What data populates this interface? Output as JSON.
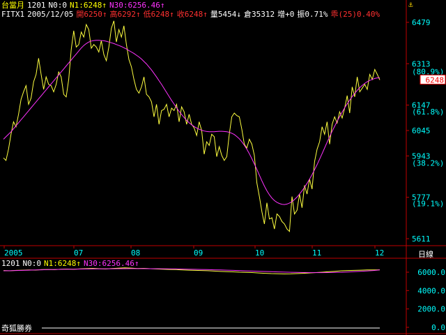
{
  "header": {
    "line1": [
      {
        "text": "台當月",
        "color": "#ffff00"
      },
      {
        "text": "1201",
        "color": "#ffffff"
      },
      {
        "text": "N0:0",
        "color": "#ffffff"
      },
      {
        "text": "N1:6248↑",
        "color": "#ffff00"
      },
      {
        "text": "N30:6256.46↑",
        "color": "#ff33ff"
      }
    ],
    "line2": [
      {
        "text": "FITX1",
        "color": "#ffffff"
      },
      {
        "text": "2005/12/05",
        "color": "#ffffff"
      },
      {
        "text": "開6250↑",
        "color": "#ff3030"
      },
      {
        "text": "高6292↑",
        "color": "#ff3030"
      },
      {
        "text": "低6248↑",
        "color": "#ff3030"
      },
      {
        "text": "收6248↑",
        "color": "#ff3030"
      },
      {
        "text": "量5454↓",
        "color": "#ffffff"
      },
      {
        "text": "倉35312",
        "color": "#ffffff"
      },
      {
        "text": "增+0",
        "color": "#ffffff"
      },
      {
        "text": "振0.71%",
        "color": "#ffffff"
      },
      {
        "text": "乖(25)0.40%",
        "color": "#ff3030"
      }
    ],
    "corner_icon": "anchor-icon",
    "corner_glyph": "⚓"
  },
  "lower_header": [
    {
      "text": "1201",
      "color": "#ffffff"
    },
    {
      "text": "N0:0",
      "color": "#ffffff"
    },
    {
      "text": "N1:6248↑",
      "color": "#ffff00"
    },
    {
      "text": "N30:6256.46↑",
      "color": "#ff33ff"
    }
  ],
  "footer_label": "奇狐勝券",
  "colors": {
    "price": "#ffff40",
    "ma": "#ff33ff",
    "axis": "#c00000",
    "ticks": "#00ffff",
    "x_labels": "#00ffff",
    "last_box": "#ff0000"
  },
  "chart_data": [
    {
      "type": "line",
      "y_ticks": [
        {
          "value": 6479,
          "label": "6479"
        },
        {
          "value": 6313,
          "label": "6313"
        },
        {
          "value": 6147,
          "label": "6147"
        },
        {
          "value": 6045,
          "label": "6045"
        },
        {
          "value": 5943,
          "label": "5943"
        },
        {
          "value": 5777,
          "label": "5777"
        },
        {
          "value": 5611,
          "label": "5611"
        }
      ],
      "fib_labels": [
        {
          "value": 6281,
          "label": "(80.9%)"
        },
        {
          "value": 6121,
          "label": "(61.8%)"
        },
        {
          "value": 5915,
          "label": "(38.2%)"
        },
        {
          "value": 5753,
          "label": "(19.1%)"
        }
      ],
      "last_value_label": "6248",
      "x_labels": [
        "2005",
        "07",
        "08",
        "09",
        "10",
        "11",
        "12"
      ],
      "x_axis_title": "日線",
      "series": [
        {
          "values": [
            5935,
            5925,
            5970,
            6030,
            6080,
            6060,
            6110,
            6170,
            6200,
            6225,
            6150,
            6175,
            6240,
            6270,
            6335,
            6270,
            6210,
            6260,
            6230,
            6225,
            6200,
            6230,
            6280,
            6260,
            6190,
            6180,
            6250,
            6370,
            6445,
            6380,
            6390,
            6440,
            6420,
            6470,
            6450,
            6375,
            6390,
            6380,
            6360,
            6405,
            6350,
            6325,
            6380,
            6455,
            6485,
            6400,
            6450,
            6420,
            6465,
            6390,
            6330,
            6300,
            6250,
            6210,
            6195,
            6220,
            6260,
            6190,
            6180,
            6160,
            6100,
            6150,
            6070,
            6125,
            6130,
            6150,
            6100,
            6135,
            6125,
            6150,
            6080,
            6140,
            6120,
            6070,
            6110,
            6070,
            6055,
            6025,
            6080,
            6045,
            5950,
            6000,
            5985,
            6030,
            6020,
            5940,
            5980,
            5945,
            5925,
            5940,
            6030,
            6100,
            6115,
            6105,
            6100,
            6050,
            5990,
            5975,
            6010,
            5990,
            5945,
            5835,
            5780,
            5720,
            5670,
            5755,
            5690,
            5695,
            5650,
            5710,
            5700,
            5680,
            5670,
            5650,
            5640,
            5780,
            5710,
            5725,
            5790,
            5735,
            5825,
            5790,
            5850,
            5810,
            5920,
            5970,
            6000,
            6060,
            6030,
            6080,
            5990,
            6070,
            6100,
            6075,
            6120,
            6095,
            6135,
            6185,
            6115,
            6220,
            6180,
            6260,
            6200,
            6215,
            6230,
            6210,
            6270,
            6250,
            6290,
            6270,
            6248
          ]
        },
        {
          "values": [
            6010,
            6020,
            6030,
            6040,
            6052,
            6064,
            6076,
            6088,
            6100,
            6112,
            6124,
            6136,
            6148,
            6160,
            6172,
            6184,
            6196,
            6208,
            6220,
            6232,
            6244,
            6256,
            6268,
            6280,
            6292,
            6304,
            6316,
            6328,
            6340,
            6352,
            6364,
            6376,
            6386,
            6394,
            6400,
            6404,
            6406,
            6407,
            6407,
            6406,
            6405,
            6403,
            6400,
            6397,
            6394,
            6390,
            6386,
            6382,
            6377,
            6372,
            6366,
            6360,
            6354,
            6347,
            6340,
            6332,
            6322,
            6312,
            6300,
            6288,
            6274,
            6260,
            6245,
            6230,
            6214,
            6198,
            6182,
            6166,
            6151,
            6136,
            6122,
            6109,
            6097,
            6086,
            6076,
            6068,
            6061,
            6055,
            6050,
            6046,
            6043,
            6041,
            6040,
            6040,
            6040,
            6041,
            6042,
            6042,
            6041,
            6040,
            6038,
            6034,
            6029,
            6021,
            6012,
            6000,
            5986,
            5970,
            5952,
            5932,
            5911,
            5889,
            5866,
            5843,
            5822,
            5803,
            5787,
            5774,
            5764,
            5757,
            5752,
            5749,
            5748,
            5750,
            5754,
            5760,
            5768,
            5778,
            5790,
            5803,
            5817,
            5833,
            5850,
            5868,
            5888,
            5908,
            5930,
            5952,
            5975,
            5998,
            6020,
            6042,
            6062,
            6082,
            6101,
            6119,
            6136,
            6152,
            6167,
            6181,
            6194,
            6206,
            6217,
            6226,
            6234,
            6241,
            6246,
            6250,
            6254,
            6256,
            6256
          ]
        }
      ]
    },
    {
      "type": "line",
      "y_ticks": [
        {
          "value": 6000,
          "label": "6000.0"
        },
        {
          "value": 4000,
          "label": "4000.0"
        },
        {
          "value": 2000,
          "label": "2000.0"
        },
        {
          "value": 0,
          "label": "0.0"
        }
      ],
      "series": [
        {
          "values": [
            6180,
            6150,
            6200,
            6220,
            6250,
            6230,
            6280,
            6300,
            6270,
            6320,
            6340,
            6310,
            6360,
            6390,
            6420,
            6380,
            6350,
            6400,
            6440,
            6480,
            6450,
            6400,
            6420,
            6380,
            6350,
            6330,
            6300,
            6280,
            6250,
            6220,
            6200,
            6180,
            6160,
            6120,
            6080,
            6060,
            6040,
            6000,
            5980,
            5960,
            5920,
            5880,
            5850,
            5830,
            5810,
            5820,
            5850,
            5880,
            5920,
            5960,
            6000,
            6050,
            6100,
            6150,
            6180,
            6200,
            6220,
            6240,
            6250,
            6256
          ]
        },
        {
          "values": [
            6150,
            6160,
            6180,
            6200,
            6220,
            6240,
            6260,
            6280,
            6300,
            6310,
            6320,
            6330,
            6340,
            6350,
            6360,
            6365,
            6370,
            6375,
            6380,
            6382,
            6384,
            6385,
            6384,
            6382,
            6378,
            6372,
            6364,
            6354,
            6342,
            6328,
            6312,
            6296,
            6278,
            6260,
            6240,
            6218,
            6196,
            6172,
            6148,
            6124,
            6100,
            6076,
            6052,
            6030,
            6010,
            5992,
            5976,
            5964,
            5956,
            5952,
            5954,
            5962,
            5976,
            5996,
            6022,
            6054,
            6092,
            6136,
            6186,
            6240
          ]
        }
      ]
    }
  ]
}
